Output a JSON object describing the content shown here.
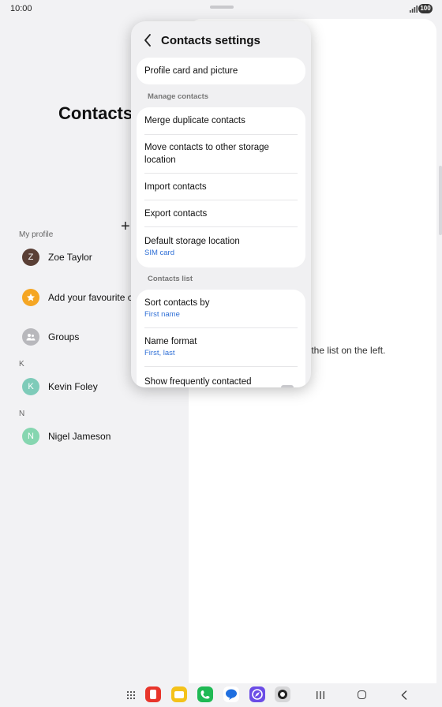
{
  "status_bar": {
    "time": "10:00",
    "battery": "100"
  },
  "left_panel": {
    "title": "Contacts",
    "sections": {
      "my_profile": "My profile",
      "k": "K",
      "n": "N"
    },
    "rows": {
      "profile": {
        "initial": "Z",
        "name": "Zoe Taylor",
        "color": "#5a3f35"
      },
      "favourites": {
        "label": "Add your favourite c",
        "color": "#f5a623"
      },
      "groups": {
        "label": "Groups",
        "color": "#b8b8bc"
      },
      "kevin": {
        "initial": "K",
        "name": "Kevin Foley",
        "color": "#7ecbb9"
      },
      "nigel": {
        "initial": "N",
        "name": "Nigel Jameson",
        "color": "#86d6b0"
      }
    }
  },
  "right_panel": {
    "hint": "m the list on the left."
  },
  "popup": {
    "title": "Contacts settings",
    "profile_card": "Profile card and picture",
    "manage_section": "Manage contacts",
    "manage_items": [
      {
        "label": "Merge duplicate contacts"
      },
      {
        "label": "Move contacts to other storage location"
      },
      {
        "label": "Import contacts"
      },
      {
        "label": "Export contacts"
      },
      {
        "label": "Default storage location",
        "sub": "SIM card"
      }
    ],
    "list_section": "Contacts list",
    "list_items": [
      {
        "label": "Sort contacts by",
        "sub": "First name"
      },
      {
        "label": "Name format",
        "sub": "First, last"
      },
      {
        "label": "Show frequently contacted"
      }
    ]
  },
  "dock": {
    "icons": [
      {
        "name": "red-app-icon",
        "color": "#e8352b"
      },
      {
        "name": "notes-app-icon",
        "color": "#f4c21a"
      },
      {
        "name": "phone-app-icon",
        "color": "#1fb954"
      },
      {
        "name": "messages-app-icon",
        "color": "#1f6fe0"
      },
      {
        "name": "browser-app-icon",
        "color": "#6b4ce6"
      },
      {
        "name": "camera-app-icon",
        "color": "#7a7a7e"
      }
    ]
  }
}
